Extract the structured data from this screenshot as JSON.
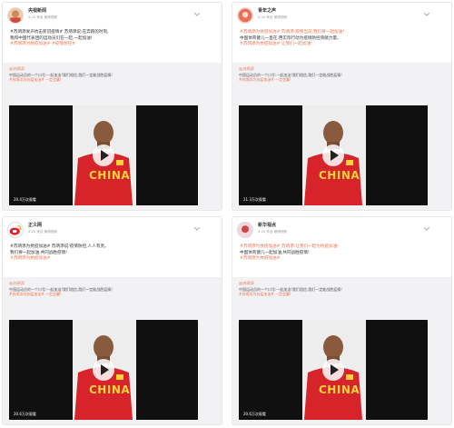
{
  "cards": [
    {
      "username": "央视新闻",
      "meta": "4-20 来自 微博视频",
      "post_lines": [
        "#苏炳添发声抗击新冠疫情# 苏炳添说:在奔跑的时刻,",
        "我和中国代表团的运动员们在一起,一起加油!",
        "#苏炳添为抗疫加油# #疫情防控#"
      ],
      "quote_user": "@苏炳添",
      "quote_lines": [
        "中国运动员的一个口号:一起加油!我们相信,我们一定能战胜疫情!",
        "#苏炳添为抗疫加油# 一定会赢!"
      ],
      "views": "20.4万次观看",
      "jersey": "CHINA"
    },
    {
      "username": "青年之声",
      "meta": "4-20 来自 微博视频",
      "post_lines": [
        "#苏炳添为抗疫加油# 苏炳添:疫情当前,我们要一起加油!",
        "中国体育健儿一直在,用实际行动为疫情防控贡献力量。",
        "#苏炳添为抗疫加油# 让我们一起加油!"
      ],
      "quote_user": "@苏炳添",
      "quote_lines": [
        "中国运动员的一个口号:一起加油!我们相信,我们一定能战胜疫情!",
        "#苏炳添为抗疫加油# 一定会赢!"
      ],
      "views": "21.3万次观看",
      "jersey": "CHINA"
    },
    {
      "username": "正义网",
      "meta": "4-20 来自 微博视频",
      "post_lines": [
        "#苏炳添为抗疫加油# 苏炳添说:疫情防控,人人有责。",
        "我们要一起加油,共同战胜疫情!",
        "#苏炳添为抗疫加油#"
      ],
      "quote_user": "@苏炳添",
      "quote_lines": [
        "中国运动员的一个口号:一起加油!我们相信,我们一定能战胜疫情!",
        "#苏炳添为抗疫加油# 一定会赢!"
      ],
      "views": "20.6万次观看",
      "jersey": "CHINA"
    },
    {
      "username": "新华视点",
      "meta": "4-20 来自 微博视频",
      "post_lines": [
        "#苏炳添为抗疫加油# 苏炳添:让我们一起为抗疫加油!",
        "中国体育健儿一起加油,共同战胜疫情!",
        "#苏炳添为抗疫加油#"
      ],
      "quote_user": "@苏炳添",
      "quote_lines": [
        "中国运动员的一个口号:一起加油!我们相信,我们一定能战胜疫情!",
        "#苏炳添为抗疫加油# 一定会赢!"
      ],
      "views": "20.6万次观看",
      "jersey": "CHINA"
    }
  ]
}
